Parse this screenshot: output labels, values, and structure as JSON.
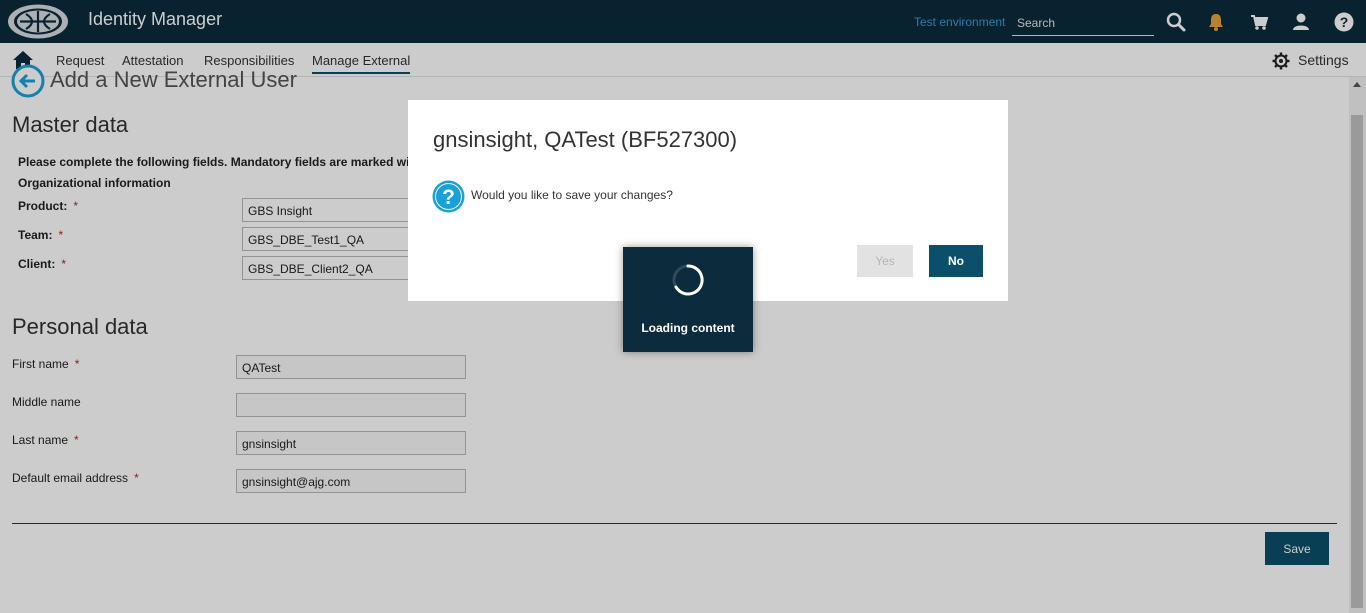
{
  "header": {
    "app_title": "Identity Manager",
    "environment": "Test environment",
    "search_placeholder": "Search",
    "colors": {
      "bar": "#0c2b3d",
      "link": "#3a9ad9",
      "notification": "#e8a33a"
    },
    "icons": [
      "search-icon",
      "bell-icon",
      "cart-icon",
      "user-icon",
      "help-icon"
    ]
  },
  "nav": {
    "items": [
      {
        "label": "Request"
      },
      {
        "label": "Attestation"
      },
      {
        "label": "Responsibilities"
      },
      {
        "label": "Manage External",
        "active": true
      }
    ],
    "settings_label": "Settings"
  },
  "page": {
    "title": "Add a New External User",
    "master_data": {
      "heading": "Master data",
      "instructions": "Please complete the following fields. Mandatory fields are marked with an",
      "subheading": "Organizational information",
      "fields": [
        {
          "label": "Product:",
          "required_mark": "*",
          "value": "GBS Insight"
        },
        {
          "label": "Team:",
          "required_mark": "*",
          "value": "GBS_DBE_Test1_QA"
        },
        {
          "label": "Client:",
          "required_mark": "*",
          "value": "GBS_DBE_Client2_QA"
        }
      ]
    },
    "personal_data": {
      "heading": "Personal data",
      "fields": [
        {
          "label": "First name",
          "required_mark": "*",
          "value": "QATest"
        },
        {
          "label": "Middle name",
          "required_mark": "",
          "value": ""
        },
        {
          "label": "Last name",
          "required_mark": "*",
          "value": "gnsinsight"
        },
        {
          "label": "Default email address",
          "required_mark": "*",
          "value": "gnsinsight@ajg.com"
        }
      ]
    },
    "save_label": "Save"
  },
  "dialog": {
    "title": "gnsinsight, QATest (BF527300)",
    "message": "Would you like to save your changes?",
    "yes_label": "Yes",
    "no_label": "No",
    "icon": "question-icon",
    "accent": "#1aa0d8"
  },
  "loading": {
    "text": "Loading content"
  }
}
